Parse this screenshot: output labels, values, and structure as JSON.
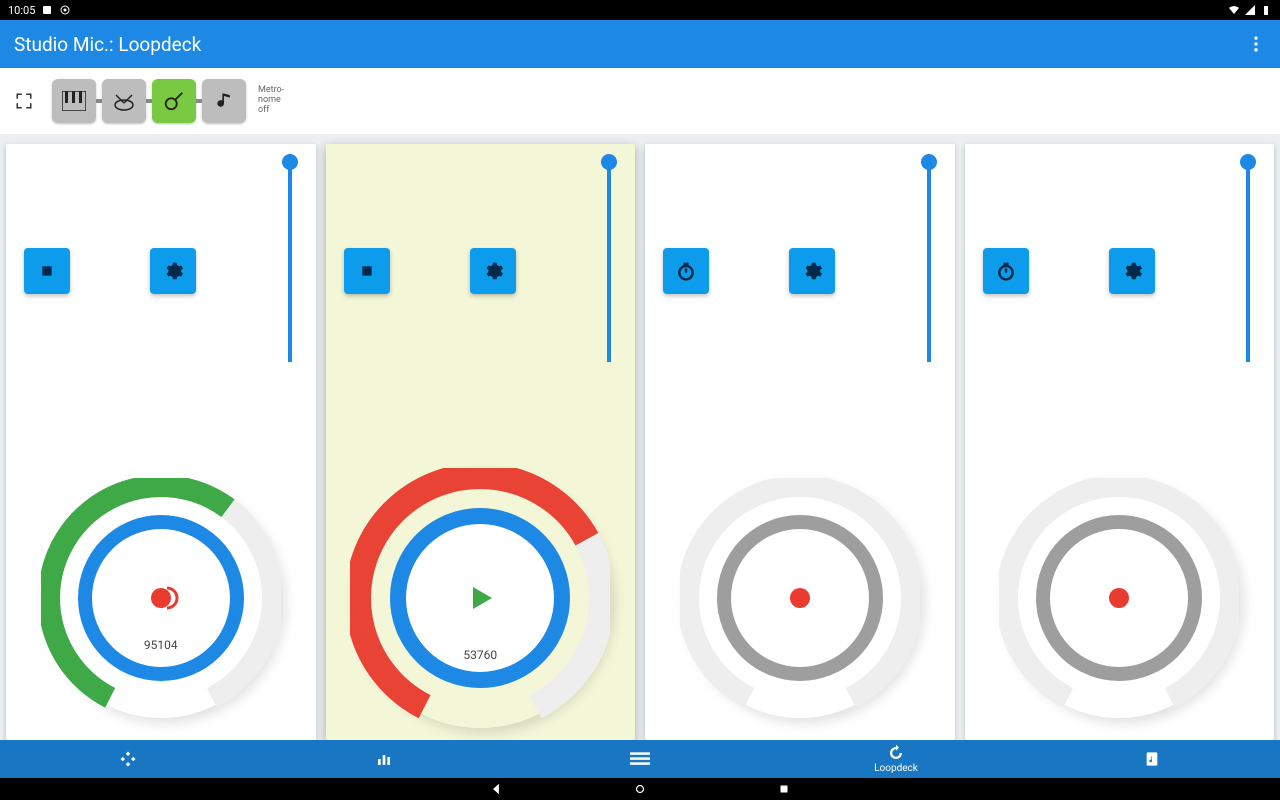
{
  "status": {
    "time": "10:05"
  },
  "appbar": {
    "title": "Studio Mic.: Loopdeck"
  },
  "toolbar": {
    "metronome_label": "Metro-\nnome\noff",
    "buttons": [
      "piano",
      "drums",
      "guitar",
      "note"
    ],
    "active_index": 2
  },
  "decks": [
    {
      "leftIcon": "stop",
      "arcColor": "#3fa847",
      "arcPct": 0.62,
      "innerRing": "#1e88e5",
      "center": "record",
      "label": "95104",
      "highlight": false
    },
    {
      "leftIcon": "stop",
      "arcColor": "#e94335",
      "arcPct": 0.7,
      "innerRing": "#1e88e5",
      "center": "play",
      "label": "53760",
      "highlight": true
    },
    {
      "leftIcon": "timer",
      "arcColor": "none",
      "arcPct": 0,
      "innerRing": "#9e9e9e",
      "center": "record",
      "label": "",
      "highlight": false
    },
    {
      "leftIcon": "timer",
      "arcColor": "none",
      "arcPct": 0,
      "innerRing": "#9e9e9e",
      "center": "record",
      "label": "",
      "highlight": false
    }
  ],
  "bottomnav": {
    "items": [
      {
        "icon": "plus",
        "label": ""
      },
      {
        "icon": "bars",
        "label": ""
      },
      {
        "icon": "lines",
        "label": ""
      },
      {
        "icon": "loop",
        "label": "Loopdeck"
      },
      {
        "icon": "note",
        "label": ""
      }
    ]
  }
}
